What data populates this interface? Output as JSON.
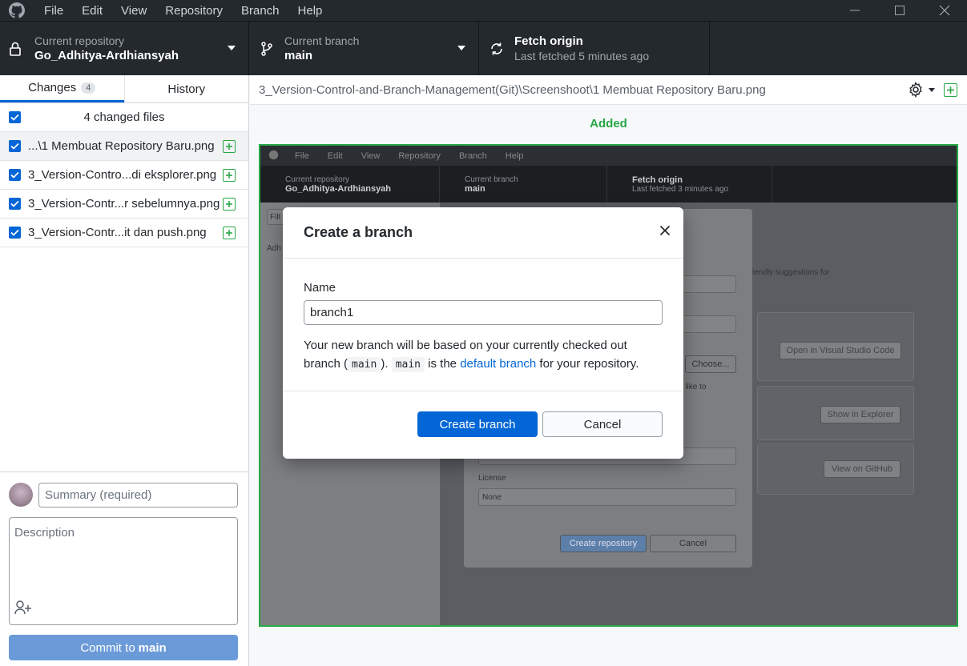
{
  "titlebar": {
    "menu": [
      "File",
      "Edit",
      "View",
      "Repository",
      "Branch",
      "Help"
    ]
  },
  "toolbar": {
    "repo_label": "Current repository",
    "repo_value": "Go_Adhitya-Ardhiansyah",
    "branch_label": "Current branch",
    "branch_value": "main",
    "fetch_label": "Fetch origin",
    "fetch_sub": "Last fetched 5 minutes ago"
  },
  "sidebar": {
    "tabs": [
      {
        "label": "Changes",
        "count": "4"
      },
      {
        "label": "History"
      }
    ],
    "changed_files_label": "4 changed files",
    "files": [
      "...\\1 Membuat Repository Baru.png",
      "3_Version-Contro...di eksplorer.png",
      "3_Version-Contr...r sebelumnya.png",
      "3_Version-Contr...it dan push.png"
    ],
    "summary_placeholder": "Summary (required)",
    "description_placeholder": "Description",
    "commit_prefix": "Commit to",
    "commit_branch": "main"
  },
  "main": {
    "path": "3_Version-Control-and-Branch-Management(Git)\\Screenshoot\\1 Membuat Repository Baru.png",
    "status": "Added"
  },
  "preview": {
    "menu": [
      "File",
      "Edit",
      "View",
      "Repository",
      "Branch",
      "Help"
    ],
    "repo_label": "Current repository",
    "repo_value": "Go_Adhitya-Ardhiansyah",
    "branch_label": "Current branch",
    "branch_value": "main",
    "fetch_label": "Fetch origin",
    "fetch_sub": "Last fetched 3 minutes ago",
    "filter_stub": "Filt",
    "list_stub": "Adh",
    "suggest_text": "iendly suggestions for",
    "choose_label": "Choose...",
    "like_text": "u like to",
    "open_vscode": "Open in Visual Studio Code",
    "show_explorer": "Show in Explorer",
    "view_github": "View on GitHub",
    "license_label": "License",
    "license_value": "None",
    "create_repo": "Create repository",
    "cancel": "Cancel"
  },
  "dialog": {
    "title": "Create a branch",
    "name_label": "Name",
    "name_value": "branch1",
    "note_1": "Your new branch will be based on your currently checked out branch (",
    "note_code_1": "main",
    "note_2": ").",
    "note_code_2": "main",
    "note_3": " is the ",
    "note_link": "default branch",
    "note_4": " for your repository.",
    "create_label": "Create branch",
    "cancel_label": "Cancel"
  }
}
